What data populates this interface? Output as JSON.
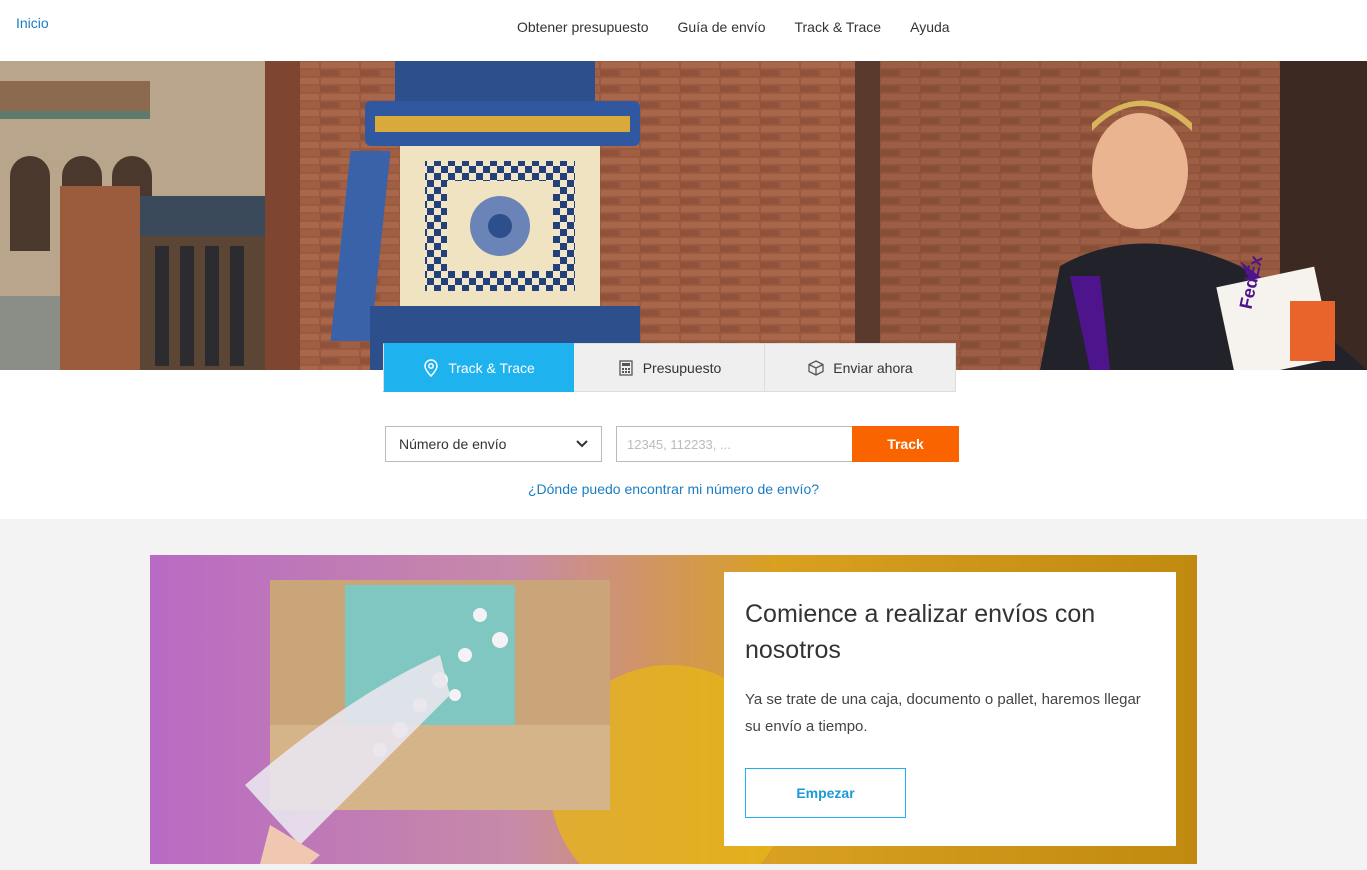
{
  "header": {
    "home_link": "Inicio",
    "nav": [
      "Obtener presupuesto",
      "Guía de envío",
      "Track & Trace",
      "Ayuda"
    ]
  },
  "tabs": [
    {
      "label": "Track & Trace",
      "icon": "location-pin-icon",
      "active": true
    },
    {
      "label": "Presupuesto",
      "icon": "calculator-icon",
      "active": false
    },
    {
      "label": "Enviar ahora",
      "icon": "package-icon",
      "active": false
    }
  ],
  "tracking": {
    "select_value": "Número de envío",
    "input_placeholder": "12345, 112233, ...",
    "button_label": "Track",
    "help_link": "¿Dónde puedo encontrar mi número de envío?"
  },
  "promo": {
    "title": "Comience a realizar envíos con nosotros",
    "body": "Ya se trate de una caja, documento o pallet, haremos llegar su envío a tiempo.",
    "button_label": "Empezar"
  },
  "colors": {
    "accent_blue": "#1eb2ee",
    "link_blue": "#1a7dc4",
    "track_orange": "#fa6400",
    "promo_gold": "#c08a10",
    "fedex_purple": "#4d148c"
  }
}
